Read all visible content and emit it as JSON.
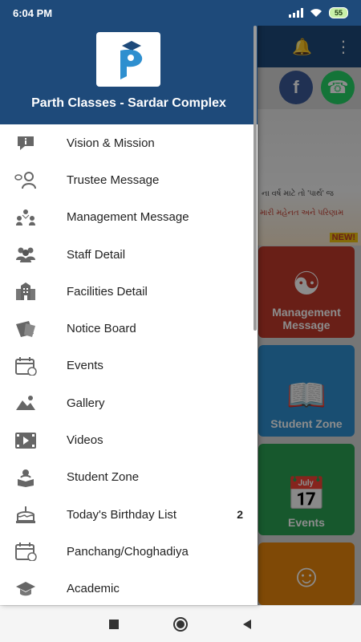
{
  "status": {
    "time": "6:04 PM",
    "battery": "55"
  },
  "app": {
    "tiles": [
      {
        "label": "Management\nMessage",
        "color": "#c0392b",
        "icon": "management-icon"
      },
      {
        "label": "Student Zone",
        "color": "#2e8fcf",
        "icon": "student-zone-icon"
      },
      {
        "label": "Events",
        "color": "#2aa052",
        "icon": "calendar-icon"
      },
      {
        "label": "",
        "color": "#e8850c",
        "icon": "support-agent-icon"
      }
    ]
  },
  "drawer": {
    "brand": "Parth Classes - Sardar Complex",
    "items": [
      {
        "label": "Vision & Mission",
        "icon": "info-icon"
      },
      {
        "label": "Trustee Message",
        "icon": "trustee-icon"
      },
      {
        "label": "Management Message",
        "icon": "management-icon"
      },
      {
        "label": "Staff Detail",
        "icon": "staff-icon"
      },
      {
        "label": "Facilities Detail",
        "icon": "building-icon"
      },
      {
        "label": "Notice Board",
        "icon": "notice-icon"
      },
      {
        "label": "Events",
        "icon": "calendar-icon"
      },
      {
        "label": "Gallery",
        "icon": "gallery-icon"
      },
      {
        "label": "Videos",
        "icon": "video-icon"
      },
      {
        "label": "Student Zone",
        "icon": "student-zone-icon"
      },
      {
        "label": "Today's Birthday List",
        "icon": "cake-icon",
        "badge": "2"
      },
      {
        "label": "Panchang/Choghadiya",
        "icon": "calendar-icon"
      },
      {
        "label": "Academic",
        "icon": "graduation-cap-icon"
      }
    ]
  }
}
